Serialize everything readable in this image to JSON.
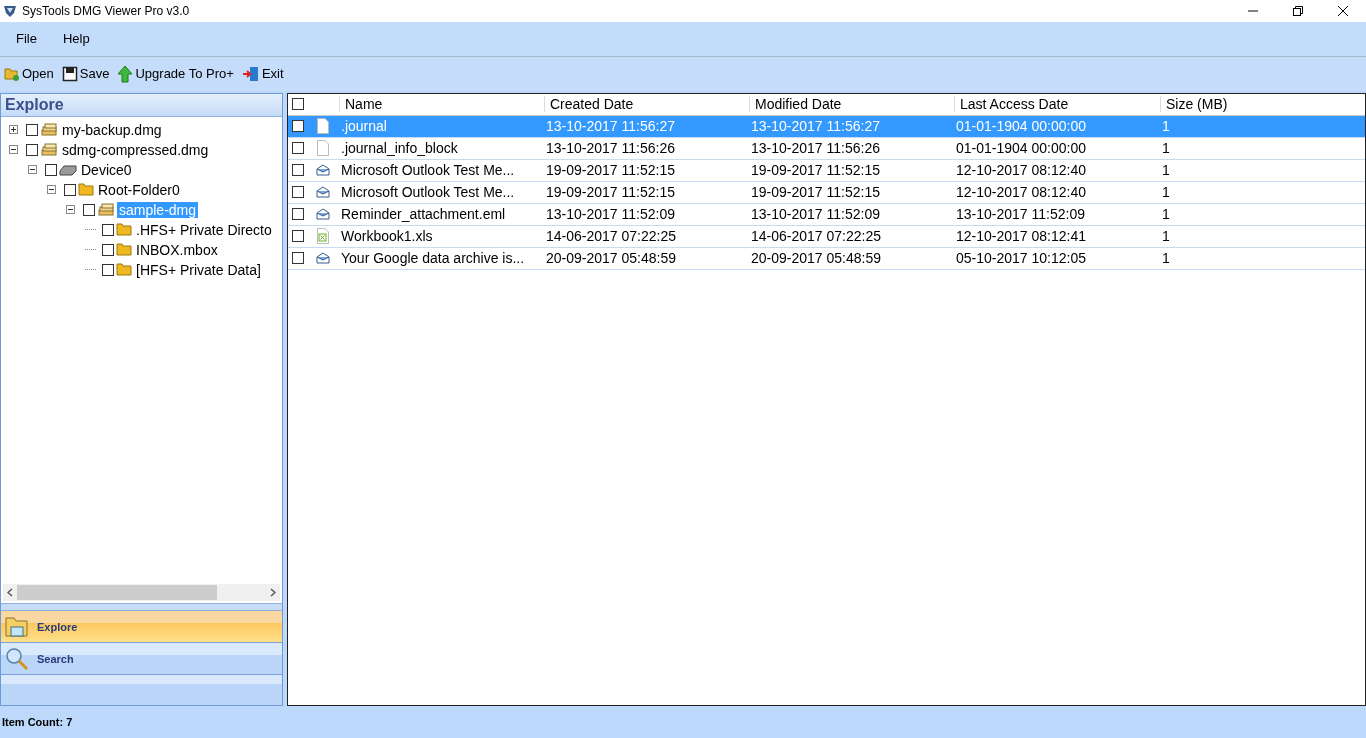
{
  "window": {
    "title": "SysTools DMG Viewer Pro v3.0"
  },
  "menu": [
    "File",
    "Help"
  ],
  "toolbar": [
    {
      "label": "Open",
      "kind": "open"
    },
    {
      "label": "Save",
      "kind": "save"
    },
    {
      "label": "Upgrade To Pro+",
      "kind": "upgrade"
    },
    {
      "label": "Exit",
      "kind": "exit"
    }
  ],
  "explore_panel": {
    "title": "Explore",
    "tree": [
      {
        "label": "my-backup.dmg",
        "kind": "archive",
        "expanded": false,
        "checked": false,
        "selected": false
      },
      {
        "label": "sdmg-compressed.dmg",
        "kind": "archive",
        "expanded": true,
        "checked": false,
        "selected": false,
        "children": [
          {
            "label": "Device0",
            "kind": "drive",
            "expanded": true,
            "checked": false,
            "selected": false,
            "children": [
              {
                "label": "Root-Folder0",
                "kind": "folder",
                "expanded": true,
                "checked": false,
                "selected": false,
                "children": [
                  {
                    "label": "sample-dmg",
                    "kind": "archive",
                    "expanded": true,
                    "checked": false,
                    "selected": true,
                    "children": [
                      {
                        "label": ".HFS+ Private Directo",
                        "kind": "folder",
                        "checked": false,
                        "selected": false
                      },
                      {
                        "label": "INBOX.mbox",
                        "kind": "folder",
                        "checked": false,
                        "selected": false
                      },
                      {
                        "label": "[HFS+ Private Data]",
                        "kind": "folder",
                        "checked": false,
                        "selected": false
                      }
                    ]
                  }
                ]
              }
            ]
          }
        ]
      }
    ]
  },
  "nav": [
    {
      "label": "Explore",
      "kind": "explore",
      "selected": true
    },
    {
      "label": "Search",
      "kind": "search",
      "selected": false
    }
  ],
  "table": {
    "columns": [
      "Name",
      "Created Date",
      "Modified Date",
      "Last Access Date",
      "Size (MB)"
    ],
    "header_checked": false,
    "rows": [
      {
        "kind": "file",
        "selected": true,
        "checked": false,
        "cells": [
          ".journal",
          "13-10-2017 11:56:27",
          "13-10-2017 11:56:27",
          "01-01-1904 00:00:00",
          "1"
        ]
      },
      {
        "kind": "file",
        "selected": false,
        "checked": false,
        "cells": [
          ".journal_info_block",
          "13-10-2017 11:56:26",
          "13-10-2017 11:56:26",
          "01-01-1904 00:00:00",
          "1"
        ]
      },
      {
        "kind": "mail",
        "selected": false,
        "checked": false,
        "cells": [
          "Microsoft Outlook Test Me...",
          "19-09-2017 11:52:15",
          "19-09-2017 11:52:15",
          "12-10-2017 08:12:40",
          "1"
        ]
      },
      {
        "kind": "mail",
        "selected": false,
        "checked": false,
        "cells": [
          "Microsoft Outlook Test Me...",
          "19-09-2017 11:52:15",
          "19-09-2017 11:52:15",
          "12-10-2017 08:12:40",
          "1"
        ]
      },
      {
        "kind": "mail",
        "selected": false,
        "checked": false,
        "cells": [
          "Reminder_attachment.eml",
          "13-10-2017 11:52:09",
          "13-10-2017 11:52:09",
          "13-10-2017 11:52:09",
          "1"
        ]
      },
      {
        "kind": "sheet",
        "selected": false,
        "checked": false,
        "cells": [
          "Workbook1.xls",
          "14-06-2017 07:22:25",
          "14-06-2017 07:22:25",
          "12-10-2017 08:12:41",
          "1"
        ]
      },
      {
        "kind": "mail",
        "selected": false,
        "checked": false,
        "cells": [
          "Your Google data archive is...",
          "20-09-2017 05:48:59",
          "20-09-2017 05:48:59",
          "05-10-2017 10:12:05",
          "1"
        ]
      }
    ]
  },
  "status_bar": {
    "text": "Item Count: 7"
  }
}
